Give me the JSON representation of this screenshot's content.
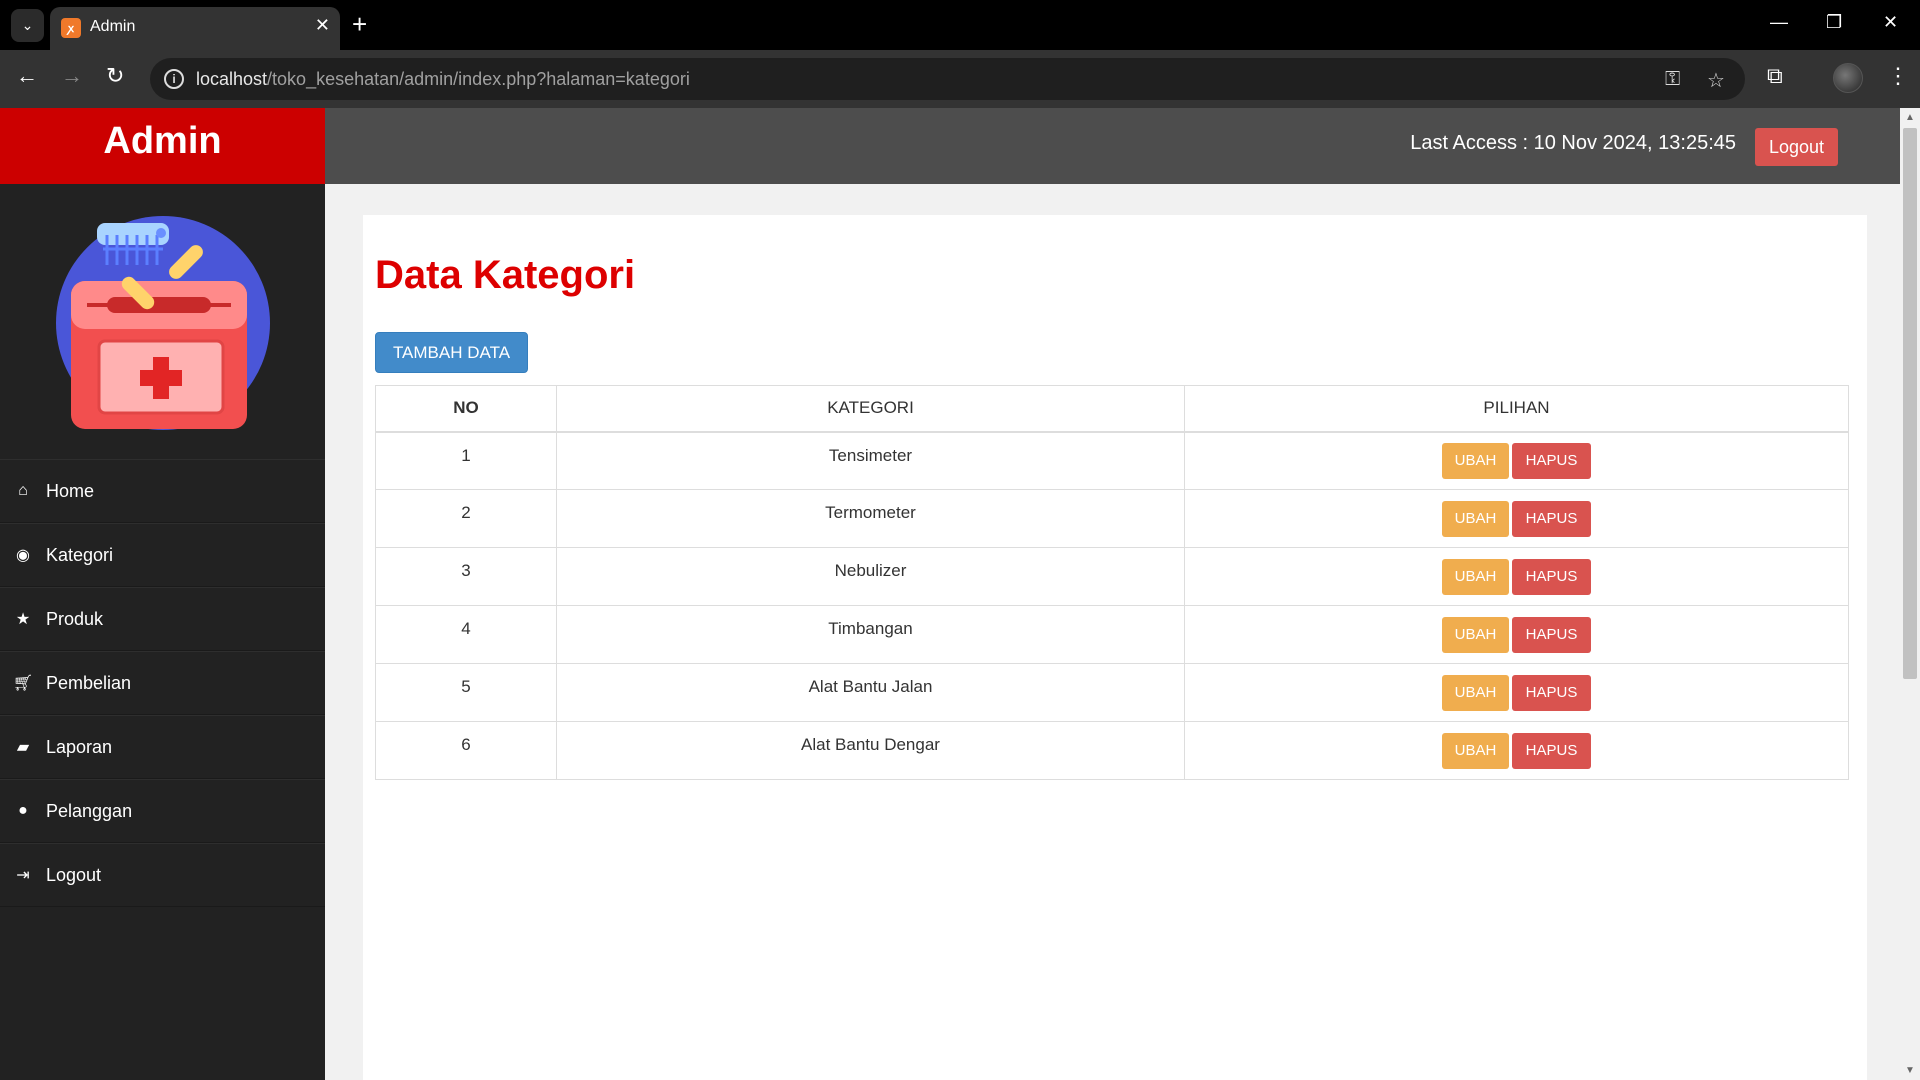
{
  "browser": {
    "tab_title": "Admin",
    "favicon": "xampp-icon",
    "url_host": "localhost",
    "url_path": "/toko_kesehatan/admin/index.php?halaman=kategori"
  },
  "header": {
    "brand": "Admin",
    "last_access": "Last Access : 10 Nov 2024, 13:25:45",
    "logout_label": "Logout"
  },
  "sidebar": {
    "items": [
      {
        "label": "Home",
        "icon": "home-icon"
      },
      {
        "label": "Kategori",
        "icon": "eye-icon"
      },
      {
        "label": "Produk",
        "icon": "star-icon"
      },
      {
        "label": "Pembelian",
        "icon": "cart-icon"
      },
      {
        "label": "Laporan",
        "icon": "book-icon"
      },
      {
        "label": "Pelanggan",
        "icon": "user-icon"
      },
      {
        "label": "Logout",
        "icon": "sign-out-icon"
      }
    ]
  },
  "main": {
    "title": "Data Kategori",
    "add_label": "TAMBAH DATA",
    "columns": [
      "NO",
      "KATEGORI",
      "PILIHAN"
    ],
    "rows": [
      {
        "no": "1",
        "kategori": "Tensimeter"
      },
      {
        "no": "2",
        "kategori": "Termometer"
      },
      {
        "no": "3",
        "kategori": "Nebulizer"
      },
      {
        "no": "4",
        "kategori": "Timbangan"
      },
      {
        "no": "5",
        "kategori": "Alat Bantu Jalan"
      },
      {
        "no": "6",
        "kategori": "Alat Bantu Dengar"
      }
    ],
    "edit_label": "UBAH",
    "delete_label": "HAPUS"
  },
  "colors": {
    "brand_red": "#cc0000",
    "title_red": "#dd0000",
    "primary_blue": "#428bca",
    "warning_orange": "#f0ad4e",
    "danger_red": "#d9534f",
    "sidebar_bg": "#222222",
    "topbar_bg": "#4d4d4d"
  }
}
